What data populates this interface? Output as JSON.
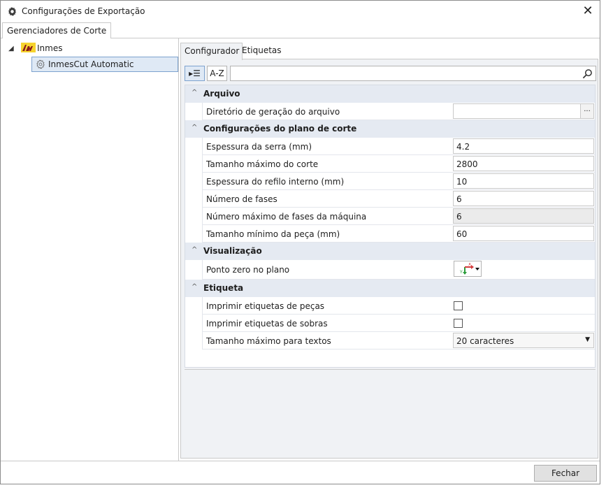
{
  "window": {
    "title": "Configurações de Exportação",
    "close_glyph": "✕"
  },
  "outer_tab": {
    "label": "Gerenciadores de Corte"
  },
  "tree": {
    "expander": "◢",
    "root_label": "Inmes",
    "child_label": "InmesCut Automatic"
  },
  "inner_tabs": {
    "active": "Configurador",
    "other": "Etiquetas"
  },
  "toolbar": {
    "categorized_glyph": "▸☰",
    "alpha_label": "A-Z",
    "search_value": ""
  },
  "categories": [
    {
      "label": "Arquivo",
      "rows": [
        {
          "name": "Diretório de geração do arquivo",
          "value": "",
          "type": "browse",
          "button": "..."
        }
      ]
    },
    {
      "label": "Configurações do plano de corte",
      "rows": [
        {
          "name": "Espessura da serra (mm)",
          "value": "4.2",
          "type": "text"
        },
        {
          "name": "Tamanho máximo do corte",
          "value": "2800",
          "type": "text"
        },
        {
          "name": "Espessura do refilo interno (mm)",
          "value": "10",
          "type": "text"
        },
        {
          "name": "Número de fases",
          "value": "6",
          "type": "text"
        },
        {
          "name": "Número máximo de fases da máquina",
          "value": "6",
          "type": "readonly"
        },
        {
          "name": "Tamanho mínimo da peça (mm)",
          "value": "60",
          "type": "text"
        }
      ]
    },
    {
      "label": "Visualização",
      "rows": [
        {
          "name": "Ponto zero no plano",
          "value": "",
          "type": "zero-point"
        }
      ]
    },
    {
      "label": "Etiqueta",
      "rows": [
        {
          "name": "Imprimir etiquetas de peças",
          "checked": false,
          "type": "checkbox"
        },
        {
          "name": "Imprimir etiquetas de sobras",
          "checked": false,
          "type": "checkbox"
        },
        {
          "name": "Tamanho máximo para textos",
          "value": "20 caracteres",
          "type": "dropdown"
        }
      ]
    }
  ],
  "chevron": "^",
  "footer": {
    "close_label": "Fechar"
  },
  "colors": {
    "selection_bg": "#dfe9f5",
    "category_bg": "#e5eaf2",
    "panel_bg": "#f0f2f5"
  },
  "icons": {
    "title": "gear-icon",
    "tree_root": "inmes-logo-icon",
    "tree_child": "gear-icon",
    "search": "search-icon",
    "zero_point": "axis-origin-icon"
  }
}
